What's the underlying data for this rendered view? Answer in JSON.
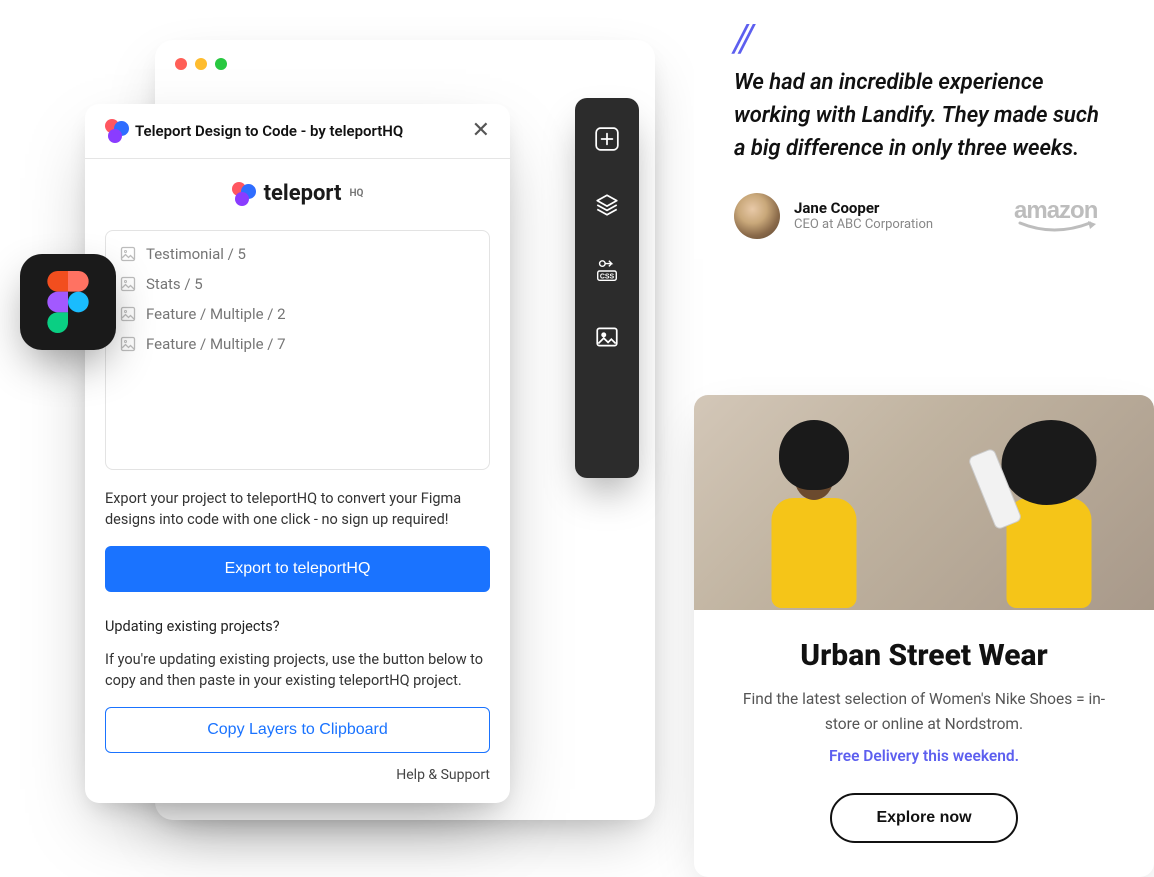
{
  "plugin": {
    "title": "Teleport Design to Code - by teleportHQ",
    "brand": "teleport",
    "brand_sup": "HQ",
    "layers": [
      "Testimonial / 5",
      "Stats / 5",
      "Feature / Multiple / 2",
      "Feature / Multiple / 7"
    ],
    "desc": "Export your project to teleportHQ to convert your Figma designs into code with one click - no sign up required!",
    "primary_btn": "Export to teleportHQ",
    "sub_heading": "Updating existing projects?",
    "update_desc": "If you're updating existing projects, use the button below to copy and then paste in your existing teleportHQ project.",
    "outline_btn": "Copy Layers to Clipboard",
    "help_link": "Help & Support"
  },
  "testimonial": {
    "quote_mark": "//",
    "text": "We had an incredible experience working with Landify. They made such a big difference in only three weeks.",
    "author_name": "Jane Cooper",
    "author_role": "CEO at ABC Corporation",
    "brand": "amazon"
  },
  "product": {
    "title": "Urban Street Wear",
    "sub": "Find the latest selection of Women's Nike Shoes = in-store or online at Nordstrom.",
    "promo": "Free Delivery this weekend.",
    "cta": "Explore now"
  },
  "toolbar_icons": [
    "plus",
    "layers",
    "css",
    "image"
  ]
}
